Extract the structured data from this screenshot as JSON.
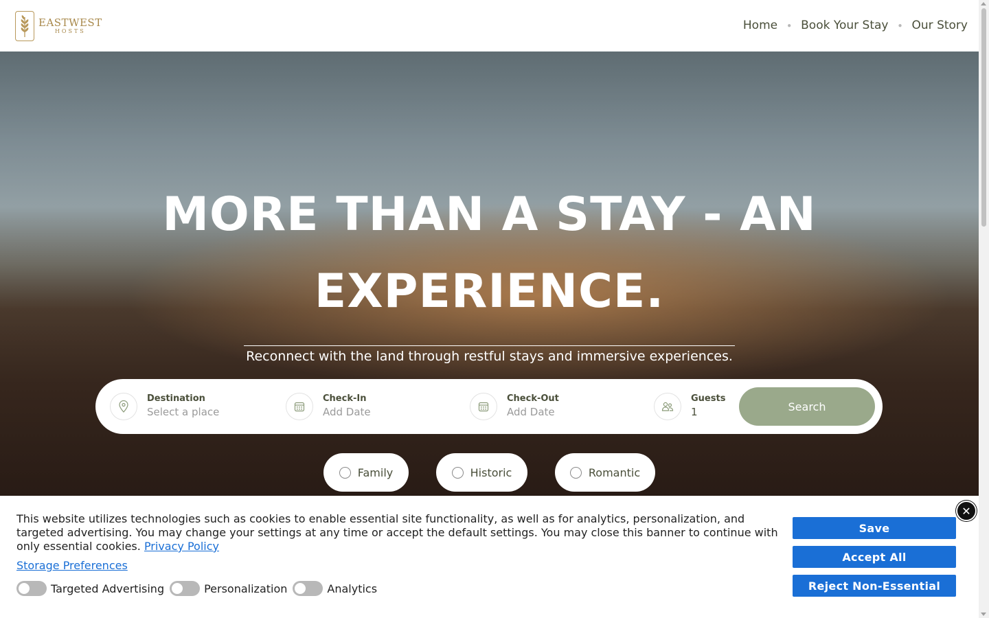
{
  "header": {
    "logo": {
      "title": "EASTWEST",
      "subtitle": "HOSTS"
    },
    "nav": [
      "Home",
      "Book Your Stay",
      "Our Story"
    ]
  },
  "hero": {
    "title_line1": "MORE THAN A STAY - AN",
    "title_line2": "EXPERIENCE.",
    "subtitle": "Reconnect with the land through restful stays and immersive experiences."
  },
  "search": {
    "destination": {
      "label": "Destination",
      "placeholder": "Select a place",
      "icon": "map-pin-icon"
    },
    "checkin": {
      "label": "Check-In",
      "placeholder": "Add Date",
      "icon": "calendar-icon"
    },
    "checkout": {
      "label": "Check-Out",
      "placeholder": "Add Date",
      "icon": "calendar-icon"
    },
    "guests": {
      "label": "Guests",
      "value": "1",
      "icon": "users-icon"
    },
    "button": "Search"
  },
  "filters": [
    "Family",
    "Historic",
    "Romantic"
  ],
  "cookie_banner": {
    "text": "This website utilizes technologies such as cookies to enable essential site functionality, as well as for analytics, personalization, and targeted advertising. You may change your settings at any time or accept the default settings. You may close this banner to continue with only essential cookies.",
    "privacy_link": "Privacy Policy",
    "preferences_link": "Storage Preferences",
    "toggles": [
      "Targeted Advertising",
      "Personalization",
      "Analytics"
    ],
    "buttons": {
      "save": "Save",
      "accept": "Accept All",
      "reject": "Reject Non-Essential"
    },
    "close_icon": "close-icon"
  },
  "colors": {
    "accent_green": "#9aa98b",
    "nav_text": "#4a4f3a",
    "link_blue": "#1a6fd6",
    "logo_gold": "#a8884a"
  }
}
